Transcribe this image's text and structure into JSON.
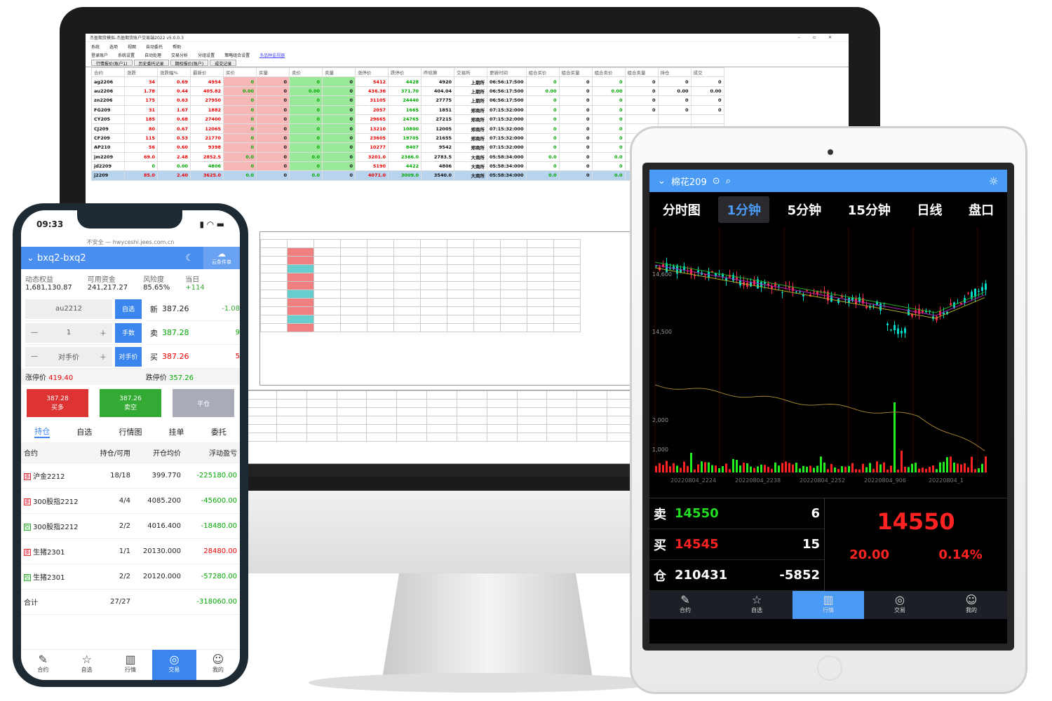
{
  "desktop": {
    "title": "杰盈期货模拟-杰盈期货账户交易端2022 v5.0.0.3",
    "menu": [
      "系统",
      "选项",
      "视图",
      "自动委托",
      "帮助"
    ],
    "toolbar": [
      "登录账户",
      "系统设置",
      "自动处理",
      "交易分析",
      "分组设置",
      "策略组合设置",
      "多品种监视器"
    ],
    "tabs": [
      "行情报价(账户1)",
      "历史委托记录",
      "期权报价(账户)",
      "成交记录"
    ],
    "columns": [
      "合约",
      "涨跌",
      "涨跌幅%",
      "最新价",
      "买价",
      "买量",
      "卖价",
      "卖量",
      "涨停价",
      "跌停价",
      "昨结算",
      "交易所",
      "更新时间",
      "组合买价",
      "组合买量",
      "组合卖价",
      "组合卖量",
      "持仓",
      "成交"
    ],
    "rows": [
      [
        "ag2206",
        "34",
        "0.69",
        "4954",
        "0",
        "0",
        "0",
        "0",
        "5412",
        "4428",
        "4920",
        "上期所",
        "06:56:17:500",
        "0",
        "0",
        "0",
        "0",
        "0",
        "0"
      ],
      [
        "au2206",
        "1.78",
        "0.44",
        "405.82",
        "0.00",
        "0",
        "0.00",
        "0",
        "436.36",
        "371.70",
        "404.04",
        "上期所",
        "06:56:17:500",
        "0.00",
        "0",
        "0.00",
        "0",
        "0.00",
        "0.00"
      ],
      [
        "zn2206",
        "175",
        "0.63",
        "27950",
        "0",
        "0",
        "0",
        "0",
        "31105",
        "24440",
        "27775",
        "上期所",
        "06:56:17:500",
        "0",
        "0",
        "0",
        "0",
        "0",
        "0"
      ],
      [
        "FG209",
        "31",
        "1.67",
        "1882",
        "0",
        "0",
        "0",
        "0",
        "2057",
        "1665",
        "1851",
        "郑商所",
        "07:15:32:000",
        "0",
        "0",
        "0",
        "0",
        "0",
        "0"
      ],
      [
        "CY205",
        "185",
        "0.68",
        "27400",
        "0",
        "0",
        "0",
        "0",
        "29665",
        "24765",
        "27215",
        "郑商所",
        "07:15:32:000",
        "0",
        "0",
        "0",
        "",
        "",
        ""
      ],
      [
        "CJ209",
        "80",
        "0.67",
        "12065",
        "0",
        "0",
        "0",
        "0",
        "13210",
        "10800",
        "12005",
        "郑商所",
        "07:15:32:000",
        "0",
        "0",
        "0",
        "",
        "",
        ""
      ],
      [
        "CF209",
        "115",
        "0.53",
        "21770",
        "0",
        "0",
        "0",
        "0",
        "23605",
        "19705",
        "21655",
        "郑商所",
        "07:15:32:000",
        "0",
        "0",
        "0",
        "",
        "",
        ""
      ],
      [
        "AP210",
        "56",
        "0.60",
        "9398",
        "0",
        "0",
        "0",
        "0",
        "10277",
        "8407",
        "9542",
        "郑商所",
        "07:15:32:000",
        "0",
        "0",
        "0",
        "",
        "",
        ""
      ],
      [
        "jm2209",
        "69.0",
        "2.48",
        "2852.5",
        "0.0",
        "0",
        "0.0",
        "0",
        "3201.0",
        "2366.0",
        "2783.5",
        "大商所",
        "05:58:34:000",
        "0.0",
        "0",
        "0.0",
        "",
        "",
        ""
      ],
      [
        "jd2209",
        "0",
        "0.00",
        "4806",
        "0",
        "0",
        "0",
        "0",
        "5190",
        "4422",
        "4806",
        "大商所",
        "05:58:34:000",
        "0",
        "0",
        "0",
        "",
        "",
        ""
      ],
      [
        "j2209",
        "85.0",
        "2.40",
        "3625.0",
        "0.0",
        "0",
        "0.0",
        "0",
        "4071.0",
        "3009.0",
        "3540.0",
        "大商所",
        "05:58:34:000",
        "0.0",
        "0",
        "0.0",
        "",
        "",
        ""
      ]
    ],
    "selected_row": 10
  },
  "tablet": {
    "symbol": "棉花209",
    "tabs": [
      "分时图",
      "1分钟",
      "5分钟",
      "15分钟",
      "日线",
      "盘口"
    ],
    "active_tab": 1,
    "price_axis": [
      "14,600",
      "14,500"
    ],
    "volume_axis": [
      "2,000",
      "1,000"
    ],
    "time_axis": [
      "20220804_2224",
      "20220804_2238",
      "20220804_2252",
      "20220804_906",
      "20220804_1"
    ],
    "sell": {
      "label": "卖",
      "price": "14550",
      "qty": "6"
    },
    "buy": {
      "label": "买",
      "price": "14545",
      "qty": "15"
    },
    "oi": {
      "label": "仓",
      "value": "210431",
      "change": "-5852"
    },
    "last": "14550",
    "change": "20.00",
    "change_pct": "0.14%",
    "nav": [
      {
        "label": "合约",
        "icon": "contract-icon"
      },
      {
        "label": "自选",
        "icon": "star-icon"
      },
      {
        "label": "行情",
        "icon": "chart-icon"
      },
      {
        "label": "交易",
        "icon": "trade-icon"
      },
      {
        "label": "我的",
        "icon": "user-icon"
      }
    ],
    "active_nav": 2,
    "colors": {
      "accent": "#4a9bf6",
      "up": "#ff2222",
      "down": "#00d0c0"
    }
  },
  "phone": {
    "time": "09:33",
    "url": "不安全 — hwyceshi.jees.com.cn",
    "account": "bxq2-bxq2",
    "cloud_label": "云条件单",
    "stats": [
      {
        "label": "动态权益",
        "value": "1,681,130.87"
      },
      {
        "label": "可用资金",
        "value": "241,217.27"
      },
      {
        "label": "风险度",
        "value": "85.65%"
      },
      {
        "label": "当日",
        "value": "+114"
      }
    ],
    "contract": "au2212",
    "btn_select": "自选",
    "qty": "1",
    "btn_lots": "手数",
    "price_mode": "对手价",
    "btn_price": "对手价",
    "quote": [
      {
        "label": "新",
        "price": "387.26",
        "extra": "-1.08"
      },
      {
        "label": "卖",
        "price": "387.28",
        "extra": "9"
      },
      {
        "label": "买",
        "price": "387.26",
        "extra": "5"
      }
    ],
    "limit_up_label": "涨停价",
    "limit_up": "419.40",
    "limit_down_label": "跌停价",
    "limit_down": "357.26",
    "buy_btn": {
      "price": "387.28",
      "label": "买多"
    },
    "sell_btn": {
      "price": "387.26",
      "label": "卖空"
    },
    "close_btn": "平仓",
    "tabs": [
      "持仓",
      "自选",
      "行情图",
      "挂单",
      "委托"
    ],
    "columns": [
      "合约",
      "持仓/可用",
      "开仓均价",
      "浮动盈亏"
    ],
    "positions": [
      {
        "side": "多",
        "name": "沪金2212",
        "qty": "18/18",
        "price": "399.770",
        "pnl": "-225180.00"
      },
      {
        "side": "多",
        "name": "300股指2212",
        "qty": "4/4",
        "price": "4085.200",
        "pnl": "-45600.00"
      },
      {
        "side": "空",
        "name": "300股指2212",
        "qty": "2/2",
        "price": "4016.400",
        "pnl": "-18480.00"
      },
      {
        "side": "多",
        "name": "生猪2301",
        "qty": "1/1",
        "price": "20130.000",
        "pnl": "28480.00"
      },
      {
        "side": "空",
        "name": "生猪2301",
        "qty": "2/2",
        "price": "20120.000",
        "pnl": "-57280.00"
      }
    ],
    "total": {
      "label": "合计",
      "qty": "27/27",
      "pnl": "-318060.00"
    },
    "nav": [
      {
        "label": "合约",
        "icon": "contract-icon"
      },
      {
        "label": "自选",
        "icon": "star-icon"
      },
      {
        "label": "行情",
        "icon": "chart-icon"
      },
      {
        "label": "交易",
        "icon": "trade-icon"
      },
      {
        "label": "我的",
        "icon": "user-icon"
      }
    ],
    "active_nav": 3
  }
}
